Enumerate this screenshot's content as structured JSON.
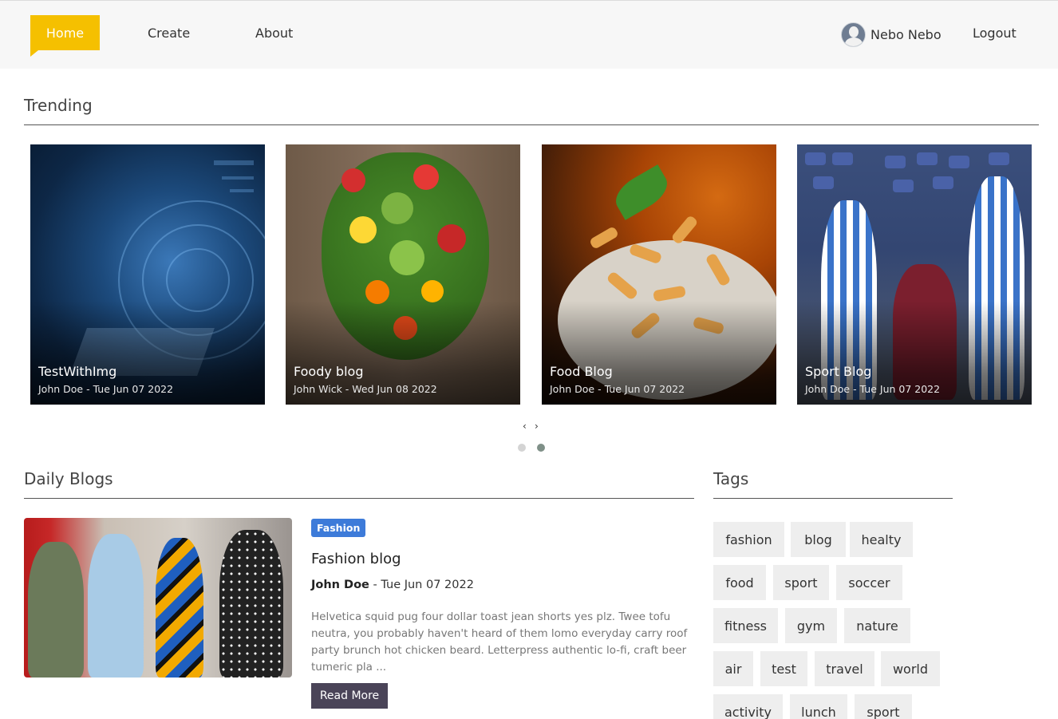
{
  "nav": {
    "home_label": "Home",
    "create_label": "Create",
    "about_label": "About",
    "user_name": "Nebo Nebo",
    "logout_label": "Logout",
    "accent_color": "#f5c000"
  },
  "trending": {
    "title": "Trending",
    "cards": [
      {
        "title": "TestWithImg",
        "meta": "John Doe - Tue Jun 07 2022"
      },
      {
        "title": "Foody blog",
        "meta": "John Wick - Wed Jun 08 2022"
      },
      {
        "title": "Food Blog",
        "meta": "John Doe - Tue Jun 07 2022"
      },
      {
        "title": "Sport Blog",
        "meta": "John Doe - Tue Jun 07 2022"
      }
    ],
    "prev_icon": "‹",
    "next_icon": "›",
    "pages": 2,
    "active_page": 2
  },
  "daily": {
    "title": "Daily Blogs",
    "post": {
      "category": "Fashion",
      "title": "Fashion blog",
      "author": "John Doe",
      "separator": " - ",
      "date": "Tue Jun 07 2022",
      "excerpt": "Helvetica squid pug four dollar toast jean shorts yes plz. Twee tofu neutra, you probably haven't heard of them lomo everyday carry roof party brunch hot chicken beard. Letterpress authentic lo-fi, craft beer tumeric pla ...",
      "read_more": "Read More"
    }
  },
  "tags": {
    "title": "Tags",
    "items": [
      "fashion",
      "blog",
      "healty",
      "food",
      "sport",
      "soccer",
      "fitness",
      "gym",
      "nature",
      "air",
      "test",
      "travel",
      "world",
      "activity",
      "lunch",
      "sport"
    ]
  }
}
